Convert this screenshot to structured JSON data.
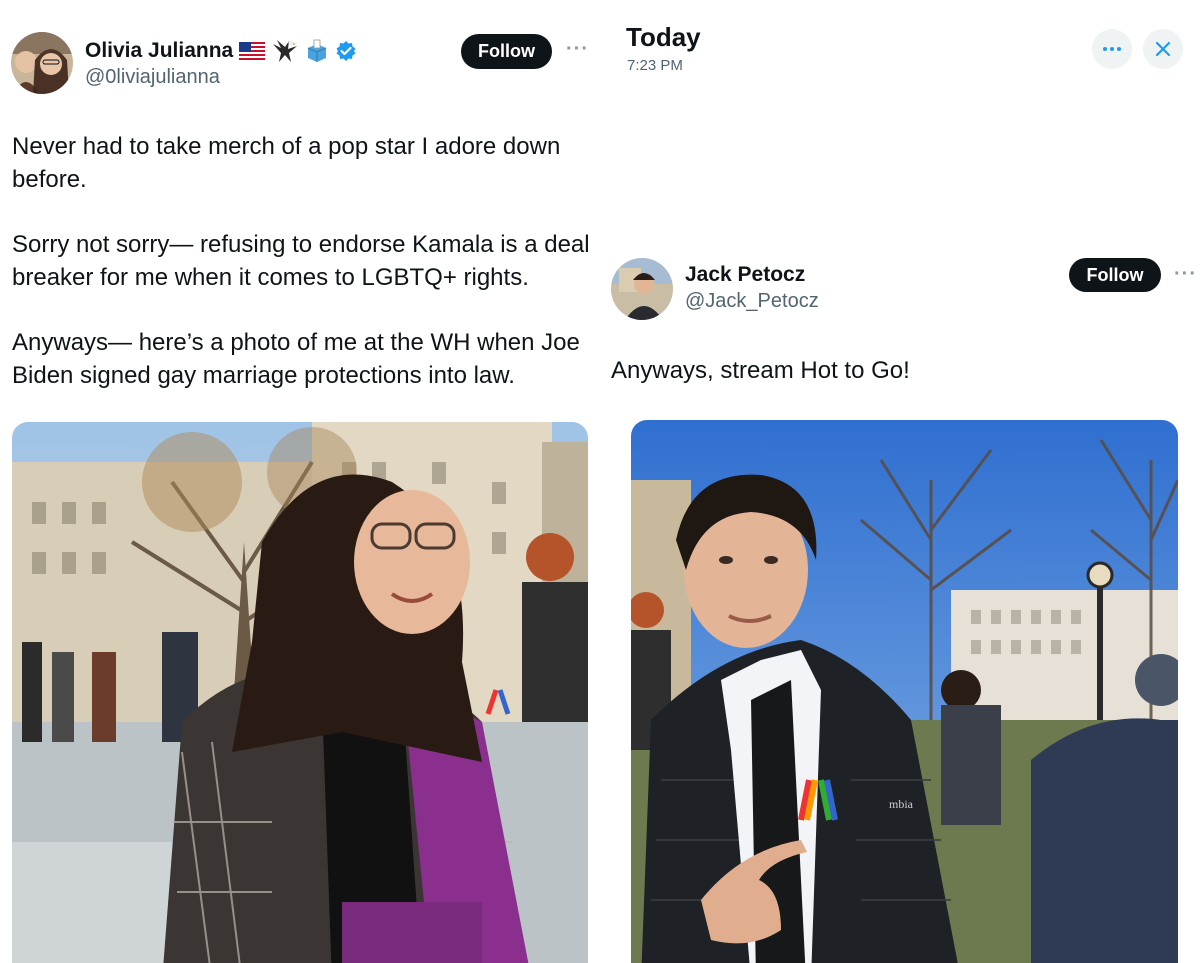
{
  "left_tweet": {
    "author_name": "Olivia Julianna",
    "flag_emoji": "🇺🇸",
    "handle": "@0liviajulianna",
    "follow_label": "Follow",
    "more_label": "···",
    "paragraphs": [
      "Never had to take merch of a pop star I adore down before.",
      "Sorry not sorry— refusing to endorse Kamala is a deal breaker for me when it comes to LGBTQ+ rights.",
      "Anyways— here’s a photo of me at the WH when Joe Biden signed gay marriage protections into law."
    ],
    "icons": [
      "us-flag-icon",
      "eagle-icon",
      "ballot-box-icon",
      "verified-badge-icon"
    ]
  },
  "right_tweet": {
    "header_title": "Today",
    "header_time": "7:23 PM",
    "author_name": "Jack Petocz",
    "handle": "@Jack_Petocz",
    "follow_label": "Follow",
    "more_label": "···",
    "text": "Anyways, stream Hot to Go!",
    "jacket_text": "mbia",
    "icons": [
      "more-options-icon",
      "close-icon"
    ]
  },
  "colors": {
    "text": "#0f1419",
    "muted": "#536471",
    "follow_bg": "#0f1419",
    "verified": "#1d9bf0",
    "close": "#1d9bf0"
  }
}
